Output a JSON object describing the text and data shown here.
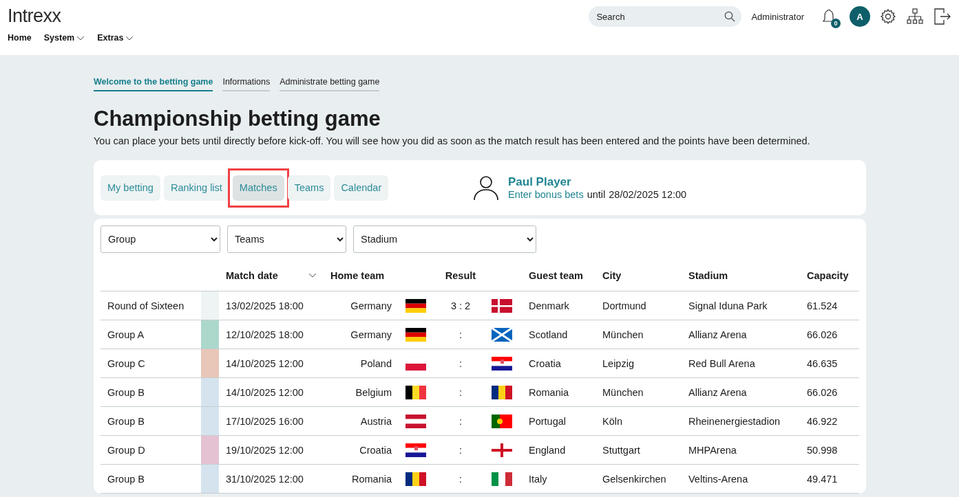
{
  "header": {
    "logo": "Intrexx",
    "menu": [
      {
        "label": "Home",
        "dropdown": false
      },
      {
        "label": "System",
        "dropdown": true
      },
      {
        "label": "Extras",
        "dropdown": true
      }
    ],
    "search": {
      "placeholder": "Search"
    },
    "user": "Administrator",
    "notifications": "0",
    "avatar": "A"
  },
  "page_tabs": [
    {
      "label": "Welcome to the betting game",
      "selected": true
    },
    {
      "label": "Informations",
      "selected": false
    },
    {
      "label": "Administrate betting game",
      "selected": false
    }
  ],
  "title": "Championship betting game",
  "intro": "You can place your bets until directly before kick-off. You will see how you did as soon as the match result has been entered and the points have been determined.",
  "nav_tabs": [
    {
      "label": "My betting",
      "selected": false
    },
    {
      "label": "Ranking list",
      "selected": false
    },
    {
      "label": "Matches",
      "selected": true
    },
    {
      "label": "Teams",
      "selected": false
    },
    {
      "label": "Calendar",
      "selected": false
    }
  ],
  "player": {
    "name": "Paul Player",
    "link": "Enter bonus bets",
    "until": "until",
    "deadline": "28/02/2025 12:00"
  },
  "filters": [
    "Group",
    "Teams",
    "Stadium"
  ],
  "table": {
    "columns": [
      "Match date",
      "Home team",
      "Result",
      "Guest team",
      "City",
      "Stadium",
      "Capacity"
    ],
    "rows": [
      {
        "group": "Round of Sixteen",
        "color": "#eef3f3",
        "date": "13/02/2025 18:00",
        "home": "Germany",
        "home_flag": {
          "kind": "de"
        },
        "result": "3 : 2",
        "guest_flag": {
          "kind": "dk"
        },
        "guest": "Denmark",
        "city": "Dortmund",
        "stadium": "Signal Iduna Park",
        "capacity": "61.524"
      },
      {
        "group": "Group A",
        "color": "#acd8cc",
        "date": "12/10/2025 18:00",
        "home": "Germany",
        "home_flag": {
          "kind": "de"
        },
        "result": ":",
        "guest_flag": {
          "kind": "sco"
        },
        "guest": "Scotland",
        "city": "München",
        "stadium": "Allianz Arena",
        "capacity": "66.026"
      },
      {
        "group": "Group C",
        "color": "#e8c6b8",
        "date": "14/10/2025 12:00",
        "home": "Poland",
        "home_flag": {
          "kind": "pl"
        },
        "result": ":",
        "guest_flag": {
          "kind": "hr"
        },
        "guest": "Croatia",
        "city": "Leipzig",
        "stadium": "Red Bull Arena",
        "capacity": "46.635"
      },
      {
        "group": "Group B",
        "color": "#d5e3ee",
        "date": "14/10/2025 12:00",
        "home": "Belgium",
        "home_flag": {
          "kind": "be"
        },
        "result": ":",
        "guest_flag": {
          "kind": "ro"
        },
        "guest": "Romania",
        "city": "München",
        "stadium": "Allianz Arena",
        "capacity": "66.026"
      },
      {
        "group": "Group B",
        "color": "#d5e3ee",
        "date": "17/10/2025 16:00",
        "home": "Austria",
        "home_flag": {
          "kind": "at"
        },
        "result": ":",
        "guest_flag": {
          "kind": "pt"
        },
        "guest": "Portugal",
        "city": "Köln",
        "stadium": "Rheinenergiestadion",
        "capacity": "46.922"
      },
      {
        "group": "Group D",
        "color": "#e4c2d2",
        "date": "19/10/2025 12:00",
        "home": "Croatia",
        "home_flag": {
          "kind": "hr"
        },
        "result": ":",
        "guest_flag": {
          "kind": "en"
        },
        "guest": "England",
        "city": "Stuttgart",
        "stadium": "MHPArena",
        "capacity": "50.998"
      },
      {
        "group": "Group B",
        "color": "#d5e3ee",
        "date": "31/10/2025 12:00",
        "home": "Romania",
        "home_flag": {
          "kind": "ro"
        },
        "result": ":",
        "guest_flag": {
          "kind": "it"
        },
        "guest": "Italy",
        "city": "Gelsenkirchen",
        "stadium": "Veltins-Arena",
        "capacity": "49.471"
      }
    ]
  }
}
